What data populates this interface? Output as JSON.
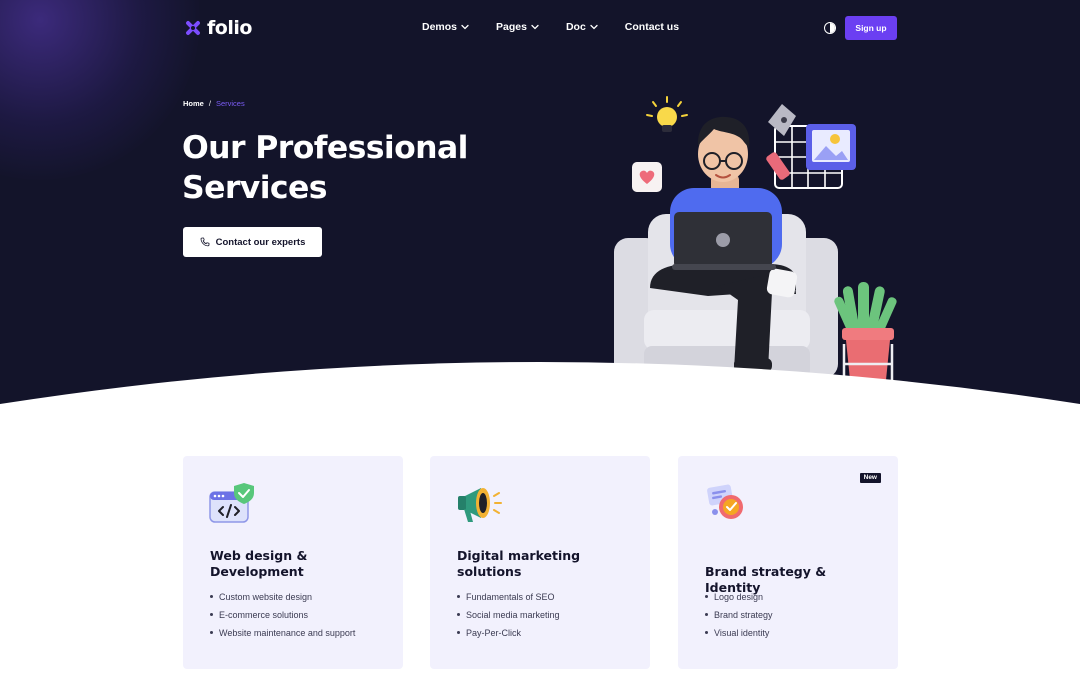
{
  "brand": {
    "name": "folio",
    "accent": "#6b3ff2",
    "dark": "#13142a"
  },
  "nav": {
    "items": [
      {
        "label": "Demos",
        "has_dropdown": true
      },
      {
        "label": "Pages",
        "has_dropdown": true
      },
      {
        "label": "Doc",
        "has_dropdown": true
      },
      {
        "label": "Contact us",
        "has_dropdown": false
      }
    ],
    "theme_toggle_icon": "contrast-icon",
    "signup_label": "Sign up"
  },
  "breadcrumb": {
    "home": "Home",
    "separator": "/",
    "current": "Services"
  },
  "hero": {
    "title_line1": "Our Professional",
    "title_line2": "Services",
    "cta_label": "Contact our experts",
    "cta_icon": "phone-icon"
  },
  "cards": [
    {
      "icon": "code-window-shield-icon",
      "title_line1": "Web design &",
      "title_line2": "Development",
      "items": [
        "Custom website design",
        "E-commerce solutions",
        "Website maintenance and support"
      ]
    },
    {
      "icon": "megaphone-icon",
      "title_line1": "Digital marketing",
      "title_line2": "solutions",
      "items": [
        "Fundamentals of SEO",
        "Social media marketing",
        "Pay-Per-Click"
      ]
    },
    {
      "icon": "brand-badge-icon",
      "badge": "New",
      "title_line1": "Brand strategy & Identity",
      "items": [
        "Logo design",
        "Brand strategy",
        "Visual identity"
      ]
    }
  ]
}
